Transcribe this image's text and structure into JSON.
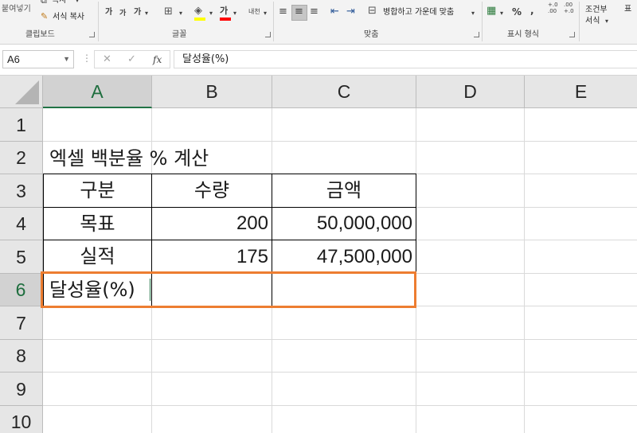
{
  "ribbon": {
    "clipboard": {
      "paste_label": "붙여넣기",
      "copy_label": "복사",
      "format_painter_label": "서식 복사",
      "group_label": "클립보드"
    },
    "font": {
      "grow_font": "가",
      "shrink_font": "가",
      "font_style": "가",
      "font_color_glyph": "가",
      "phonetic_glyph": "내천",
      "group_label": "글꼴"
    },
    "alignment": {
      "merge_center_label": "병합하고 가운데 맞춤",
      "group_label": "맞춤"
    },
    "number": {
      "percent_glyph": "%",
      "comma_glyph": ",",
      "increase_decimal_glyph": "+.0 .00",
      "decrease_decimal_glyph": ".00 +.0",
      "group_label": "표시 형식"
    },
    "styles": {
      "conditional_format_label": "조건부 서식",
      "next_label": "표"
    }
  },
  "formula_bar": {
    "name_box": "A6",
    "cancel_glyph": "✕",
    "enter_glyph": "✓",
    "fx_glyph": "fx",
    "value": "달성율(%)"
  },
  "grid": {
    "columns": [
      "A",
      "B",
      "C",
      "D",
      "E"
    ],
    "rows": [
      "1",
      "2",
      "3",
      "4",
      "5",
      "6",
      "7",
      "8",
      "9",
      "10"
    ],
    "selected_cell": "A6",
    "cells": {
      "A2": "엑셀 백분율 % 계산",
      "A3": "구분",
      "B3": "수량",
      "C3": "금액",
      "A4": "목표",
      "B4": "200",
      "C4": "50,000,000",
      "A5": "실적",
      "B5": "175",
      "C5": "47,500,000",
      "A6": "달성율(%)"
    }
  },
  "colors": {
    "excel_green": "#217346",
    "selection_orange": "#ed7d31",
    "header_gray": "#e6e6e6",
    "ribbon_gray": "#f3f3f3"
  }
}
